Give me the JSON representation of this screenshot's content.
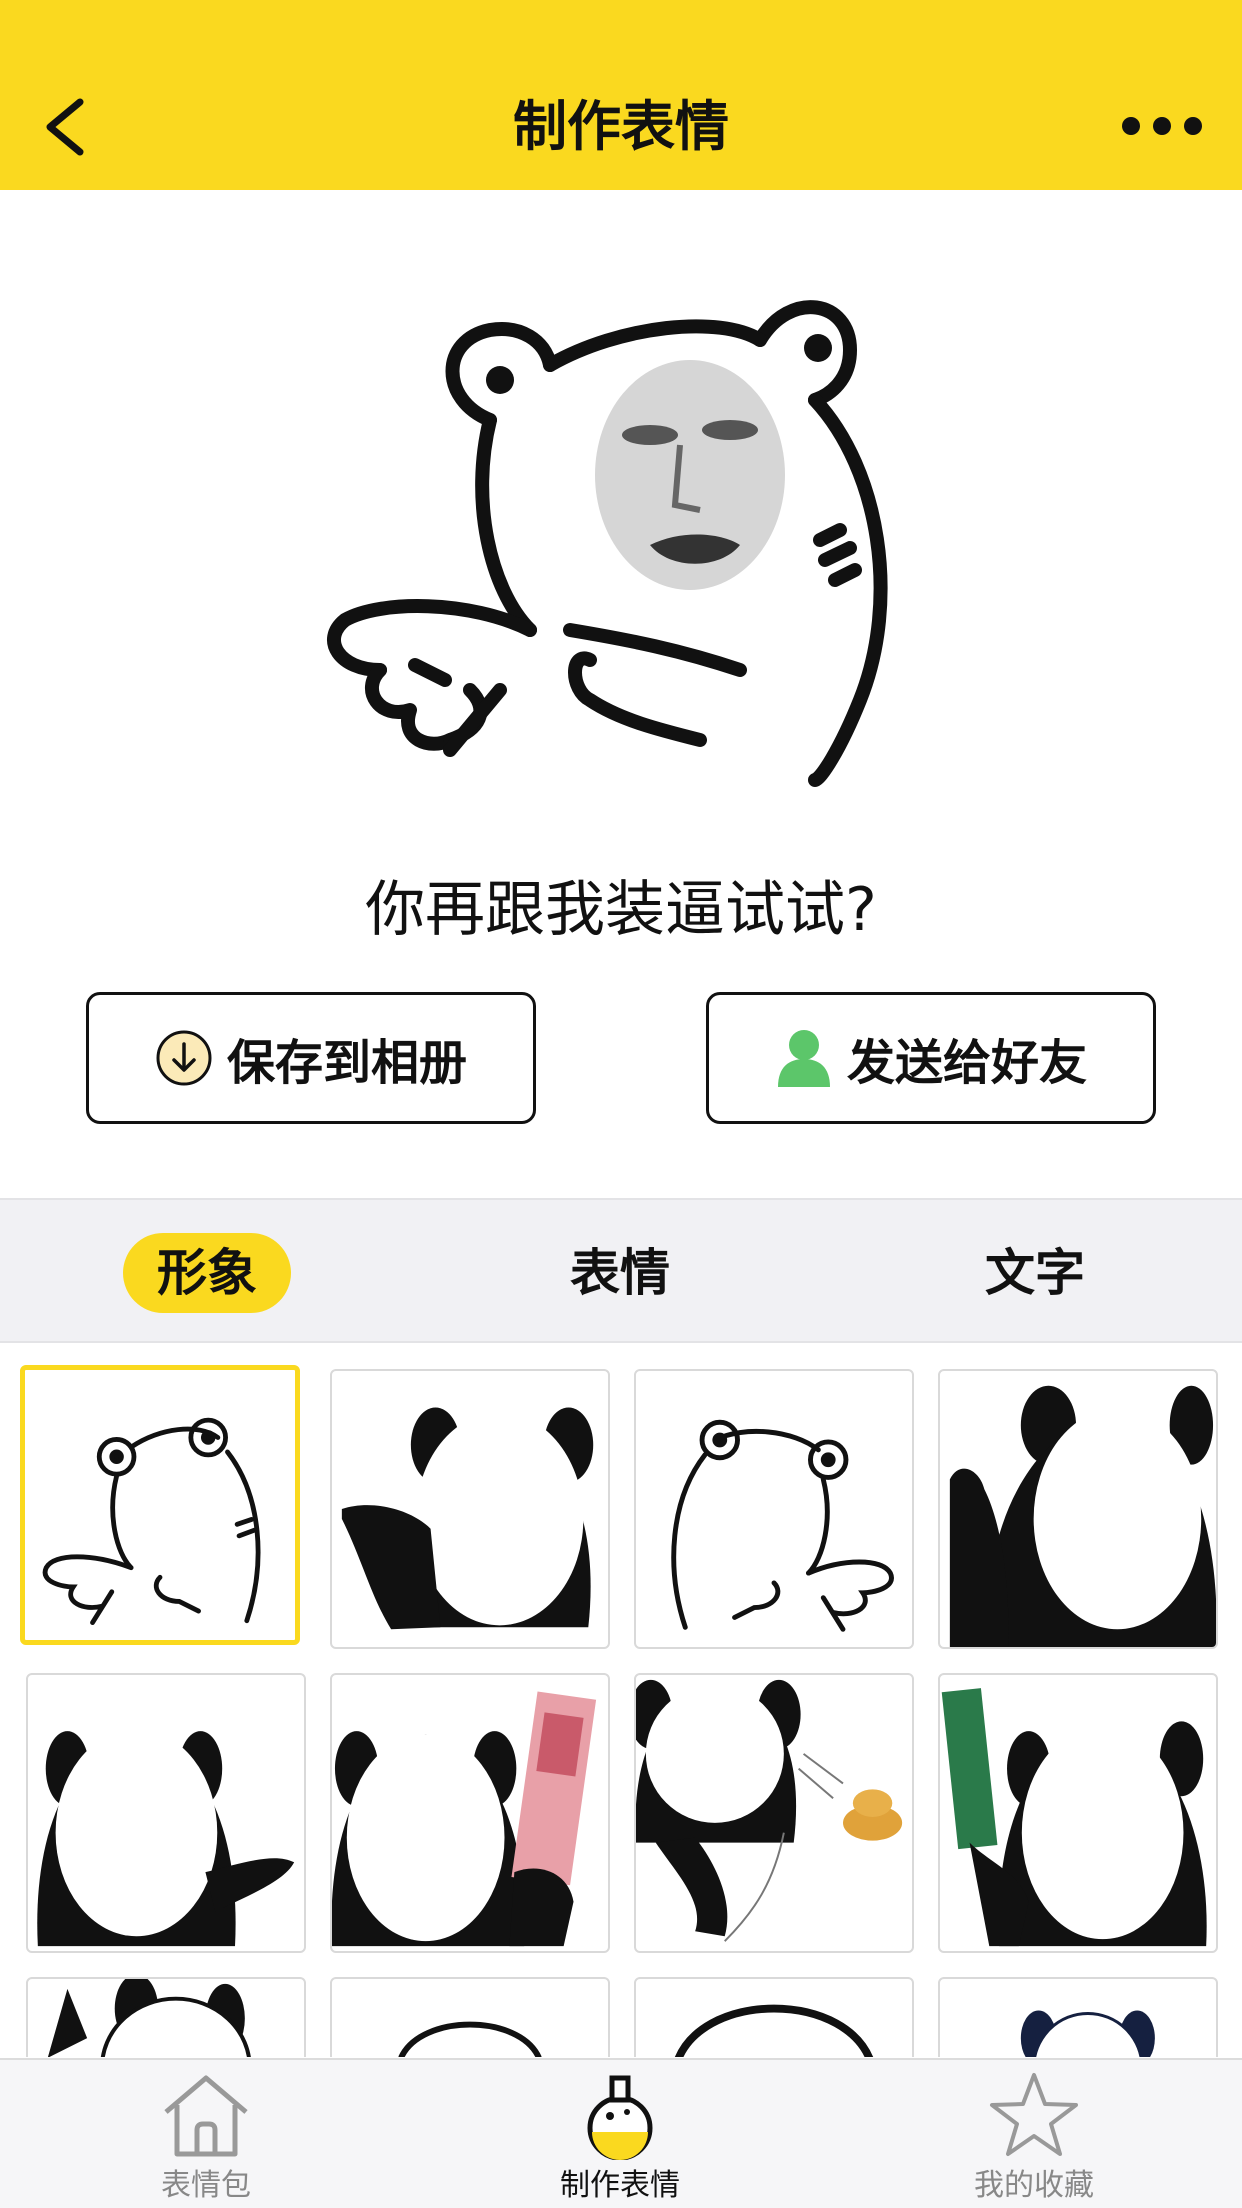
{
  "header": {
    "title": "制作表情",
    "back_icon": "chevron-left-icon",
    "more_icon": "ellipsis-icon",
    "accent": "#fad91f"
  },
  "preview": {
    "caption": "你再跟我装逼试试?"
  },
  "actions": {
    "save_label": "保存到相册",
    "save_icon": "download-circle-icon",
    "send_label": "发送给好友",
    "send_icon": "person-icon"
  },
  "tabs": [
    {
      "label": "形象",
      "active": true
    },
    {
      "label": "表情",
      "active": false
    },
    {
      "label": "文字",
      "active": false
    }
  ],
  "grid": {
    "selected_index": 0,
    "items": [
      "bear-pointing-left",
      "panda-pointing-left",
      "bear-pointing-right",
      "panda-waving",
      "panda-pointing-right",
      "panda-holding-cash",
      "panda-throwing-poop",
      "panda-holding-money",
      "panda-partial",
      "panda-partial",
      "panda-partial",
      "panda-partial"
    ]
  },
  "bottom_nav": [
    {
      "label": "表情包",
      "icon": "house-icon",
      "active": false
    },
    {
      "label": "制作表情",
      "icon": "flask-icon",
      "active": true
    },
    {
      "label": "我的收藏",
      "icon": "star-icon",
      "active": false
    }
  ]
}
